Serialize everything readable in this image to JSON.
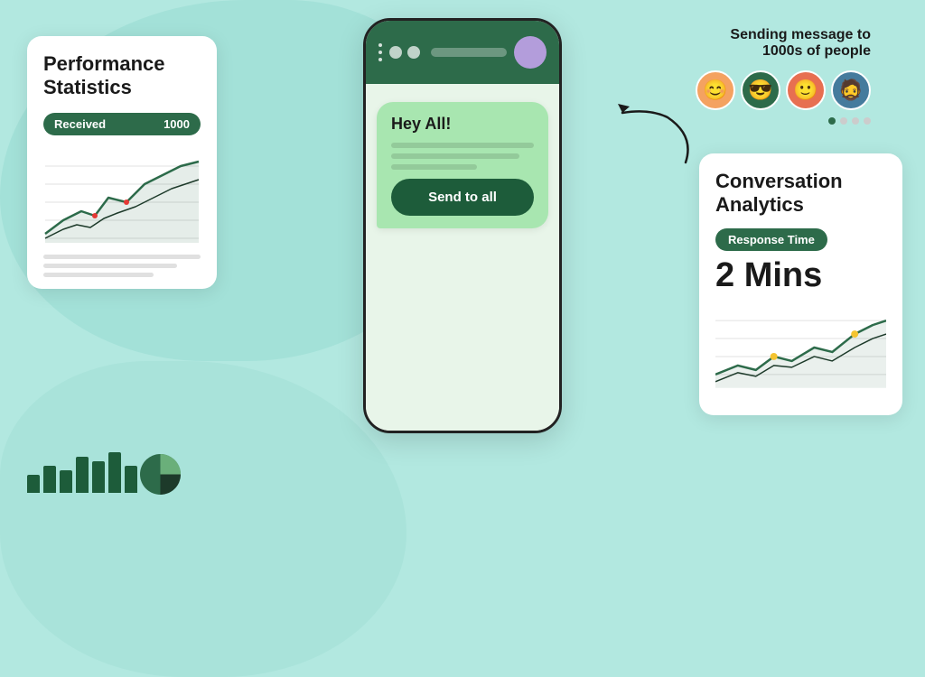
{
  "background": {
    "color": "#b2e8e0"
  },
  "left_card": {
    "title": "Performance Statistics",
    "badge_label": "Received",
    "badge_value": "1000",
    "chart": {
      "lines": 3
    }
  },
  "phone": {
    "message": {
      "greeting": "Hey All!",
      "lines": 2
    },
    "send_button": "Send to all"
  },
  "sending_section": {
    "title_line1": "Sending message to",
    "title_line2": "1000s of people",
    "avatars": [
      "😊",
      "😎",
      "🙂",
      "🧔"
    ]
  },
  "right_card": {
    "title": "Conversation Analytics",
    "badge_label": "Response Time",
    "time_value": "2 Mins"
  },
  "bar_chart": {
    "bars": [
      20,
      30,
      25,
      40,
      35,
      45,
      30
    ]
  },
  "icons": {
    "arrow_curved": "curved-arrow-icon",
    "bar_chart": "bar-chart-icon",
    "pie_chart": "pie-chart-icon"
  }
}
